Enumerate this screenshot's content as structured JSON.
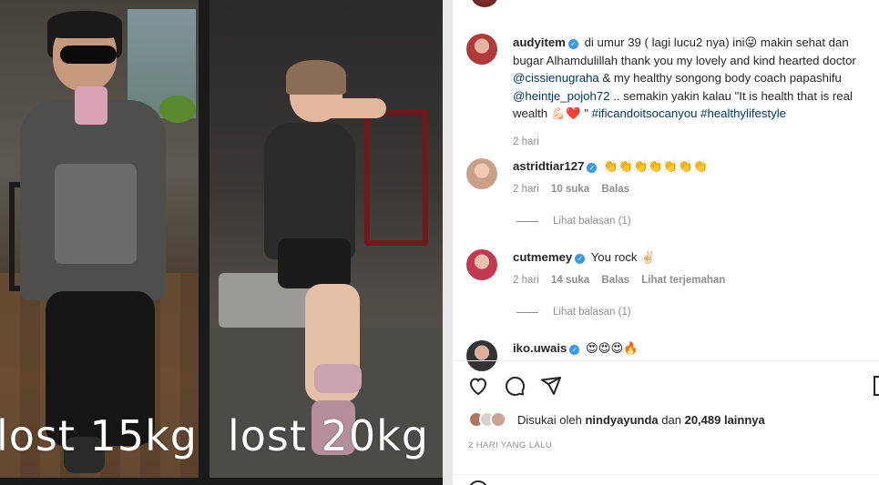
{
  "media": {
    "left_caption": "lost 15kg",
    "right_caption": "lost 20kg"
  },
  "post": {
    "username": "audyitem",
    "caption_parts": [
      {
        "type": "text",
        "text": "di umur 39 ( lagi lucu2 nya) ini"
      },
      {
        "type": "emoji",
        "text": "😜"
      },
      {
        "type": "text",
        "text": " makin sehat dan bugar Alhamdulillah thank you my lovely and kind hearted doctor "
      },
      {
        "type": "link",
        "text": "@cissienugraha"
      },
      {
        "type": "text",
        "text": " & my healthy songong body coach papashifu "
      },
      {
        "type": "link",
        "text": "@heintje_pojoh72"
      },
      {
        "type": "text",
        "text": " .. semakin yakin kalau \"It is health that is real wealth "
      },
      {
        "type": "emoji",
        "text": "💪🏻❤️"
      },
      {
        "type": "text",
        "text": " \" "
      },
      {
        "type": "link",
        "text": "#ificandoitsocanyou"
      },
      {
        "type": "text",
        "text": " "
      },
      {
        "type": "link",
        "text": "#healthylifestyle"
      }
    ],
    "time": "2 hari"
  },
  "comments": [
    {
      "username": "astridtiar127",
      "text": "👏👏👏👏👏👏👏",
      "time": "2 hari",
      "likes": "10 suka",
      "reply_label": "Balas",
      "translate_label": "",
      "view_replies": "Lihat balasan (1)"
    },
    {
      "username": "cutmemey",
      "text": "You rock ✌🏻",
      "time": "2 hari",
      "likes": "14 suka",
      "reply_label": "Balas",
      "translate_label": "Lihat terjemahan",
      "view_replies": "Lihat balasan (1)"
    },
    {
      "username": "iko.uwais",
      "text": "😍😍😍🔥"
    }
  ],
  "likes": {
    "prefix": "Disukai oleh",
    "user": "nindyayunda",
    "middle": "dan",
    "count": "20,489 lainnya"
  },
  "date": "2 HARI YANG LALU",
  "icons": [
    "heart-icon",
    "comment-icon",
    "share-icon",
    "bookmark-icon",
    "smile-icon"
  ],
  "colors": {
    "link": "#00376b",
    "muted": "#8e8e8e",
    "verified": "#3897f0"
  }
}
